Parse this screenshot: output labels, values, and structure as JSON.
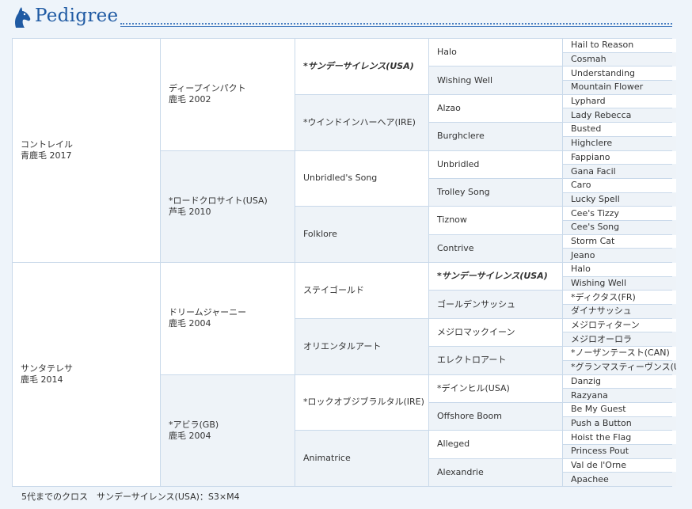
{
  "title": "Pedigree",
  "footer": "5代までのクロス　サンデーサイレンス(USA)：S3×M4",
  "g1": [
    {
      "name": "コントレイル",
      "detail": "青鹿毛 2017"
    },
    {
      "name": "サンタテレサ",
      "detail": "鹿毛 2014"
    }
  ],
  "g2": [
    {
      "name": "ディープインパクト",
      "detail": "鹿毛 2002"
    },
    {
      "name": "*ロードクロサイト(USA)",
      "detail": "芦毛 2010"
    },
    {
      "name": "ドリームジャーニー",
      "detail": "鹿毛 2004"
    },
    {
      "name": "*アビラ(GB)",
      "detail": "鹿毛 2004"
    }
  ],
  "g3": [
    "*サンデーサイレンス(USA)",
    "*ウインドインハーヘア(IRE)",
    "Unbridled's Song",
    "Folklore",
    "ステイゴールド",
    "オリエンタルアート",
    "*ロックオブジブラルタル(IRE)",
    "Animatrice"
  ],
  "g4": [
    "Halo",
    "Wishing Well",
    "Alzao",
    "Burghclere",
    "Unbridled",
    "Trolley Song",
    "Tiznow",
    "Contrive",
    "*サンデーサイレンス(USA)",
    "ゴールデンサッシュ",
    "メジロマックイーン",
    "エレクトロアート",
    "*デインヒル(USA)",
    "Offshore Boom",
    "Alleged",
    "Alexandrie"
  ],
  "g5": [
    "Hail to Reason",
    "Cosmah",
    "Understanding",
    "Mountain Flower",
    "Lyphard",
    "Lady Rebecca",
    "Busted",
    "Highclere",
    "Fappiano",
    "Gana Facil",
    "Caro",
    "Lucky Spell",
    "Cee's Tizzy",
    "Cee's Song",
    "Storm Cat",
    "Jeano",
    "Halo",
    "Wishing Well",
    "*ディクタス(FR)",
    "ダイナサッシュ",
    "メジロティターン",
    "メジロオーロラ",
    "*ノーザンテースト(CAN)",
    "*グランマスティーヴンス(USA)",
    "Danzig",
    "Razyana",
    "Be My Guest",
    "Push a Button",
    "Hoist the Flag",
    "Princess Pout",
    "Val de l'Orne",
    "Apachee"
  ],
  "highlight": [
    "*サンデーサイレンス(USA)"
  ],
  "colors": {
    "accent": "#1f5aa3",
    "grid": "#c9d9ea",
    "alt_row": "#eef3f8",
    "background": "#eef4fa"
  },
  "icons": {
    "logo": "horse-head-icon"
  }
}
